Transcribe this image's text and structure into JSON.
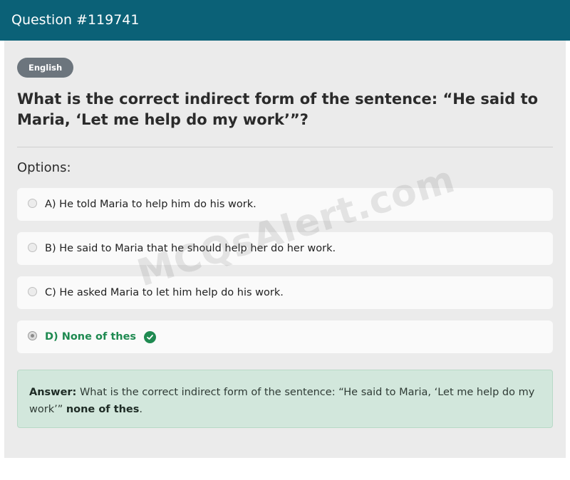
{
  "header": {
    "title": "Question #119741"
  },
  "tag": {
    "label": "English"
  },
  "question": {
    "text": "What is the correct indirect form of the sentence: “He said to Maria, ‘Let me help do my work’”?"
  },
  "options_label": "Options:",
  "options": [
    {
      "label": "A) He told Maria to help him do his work.",
      "selected": false,
      "correct": false
    },
    {
      "label": "B) He said to Maria that he should help her do her work.",
      "selected": false,
      "correct": false
    },
    {
      "label": "C) He asked Maria to let him help do his work.",
      "selected": false,
      "correct": false
    },
    {
      "label": "D) None of thes",
      "selected": true,
      "correct": true
    }
  ],
  "answer": {
    "prefix": "Answer:",
    "text": " What is the correct indirect form of the sentence: “He said to Maria, ‘Let me help do my work’”",
    "highlight": "none of thes",
    "suffix": "."
  },
  "watermark": "MCQsAlert.com",
  "colors": {
    "header_bg": "#0b6177",
    "correct": "#1f8a51",
    "answer_bg": "#d2e7dc"
  }
}
